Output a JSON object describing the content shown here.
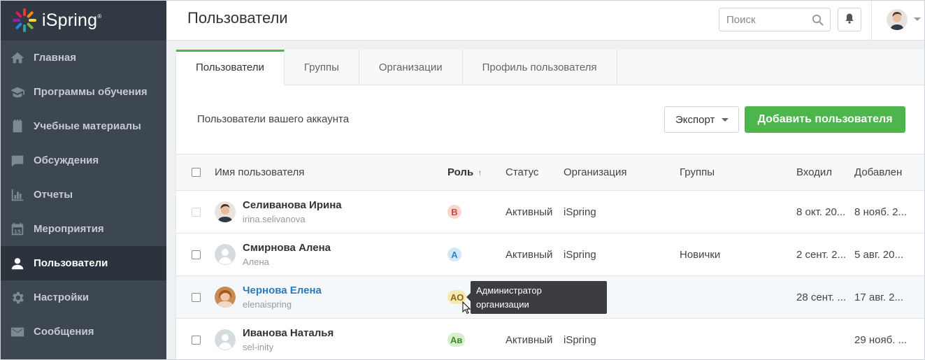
{
  "app": {
    "logo_text": "iSpring"
  },
  "sidebar": {
    "items": [
      {
        "label": "Главная",
        "icon": "home-icon",
        "active": false
      },
      {
        "label": "Программы обучения",
        "icon": "graduation-cap-icon",
        "active": false
      },
      {
        "label": "Учебные материалы",
        "icon": "notebook-icon",
        "active": false
      },
      {
        "label": "Обсуждения",
        "icon": "chat-icon",
        "active": false
      },
      {
        "label": "Отчеты",
        "icon": "bar-chart-icon",
        "active": false
      },
      {
        "label": "Мероприятия",
        "icon": "calendar-icon",
        "active": false
      },
      {
        "label": "Пользователи",
        "icon": "user-icon",
        "active": true
      },
      {
        "label": "Настройки",
        "icon": "gear-icon",
        "active": false
      },
      {
        "label": "Сообщения",
        "icon": "envelope-icon",
        "active": false
      }
    ]
  },
  "header": {
    "title": "Пользователи",
    "search_placeholder": "Поиск"
  },
  "tabs": [
    {
      "label": "Пользователи",
      "active": true
    },
    {
      "label": "Группы",
      "active": false
    },
    {
      "label": "Организации",
      "active": false
    },
    {
      "label": "Профиль пользователя",
      "active": false
    }
  ],
  "toolbar": {
    "label": "Пользователи вашего аккаунта",
    "export_label": "Экспорт",
    "add_label": "Добавить пользователя"
  },
  "table": {
    "columns": {
      "name": "Имя пользователя",
      "role": "Роль",
      "role_sort": "↑",
      "status": "Статус",
      "org": "Организация",
      "groups": "Группы",
      "login": "Входил",
      "added": "Добавлен"
    },
    "rows": [
      {
        "name": "Селиванова Ирина",
        "login": "irina.selivanova",
        "role": "В",
        "role_bg": "#f9d6d0",
        "role_fg": "#c9493a",
        "status": "Активный",
        "org": "iSpring",
        "groups": "",
        "last_login": "8 окт. 20...",
        "added": "8 нояб. 2..."
      },
      {
        "name": "Смирнова Алена",
        "login": "Алена",
        "role": "А",
        "role_bg": "#d3e8f7",
        "role_fg": "#2f83c5",
        "status": "Активный",
        "org": "iSpring",
        "groups": "Новички",
        "last_login": "2 сент. 2...",
        "added": "5 авг. 20..."
      },
      {
        "name": "Чернова Елена",
        "login": "elenaispring",
        "role": "АО",
        "role_bg": "#f7e9b4",
        "role_fg": "#8a6a12",
        "status": "",
        "org": "",
        "groups": "",
        "last_login": "28 сент. ...",
        "added": "17 авг. 2..."
      },
      {
        "name": "Иванова Наталья",
        "login": "sel-inity",
        "role": "Ав",
        "role_bg": "#d6efcc",
        "role_fg": "#3f8b2e",
        "status": "Активный",
        "org": "iSpring",
        "groups": "",
        "last_login": "",
        "added": "29 нояб. ..."
      }
    ]
  },
  "tooltip": {
    "line1": "Администратор",
    "line2": "организации"
  },
  "colors": {
    "sidebar_bg": "#3d4752",
    "sidebar_active": "#2b333c",
    "accent_green": "#4cb54b",
    "link_blue": "#2c7ab8"
  }
}
